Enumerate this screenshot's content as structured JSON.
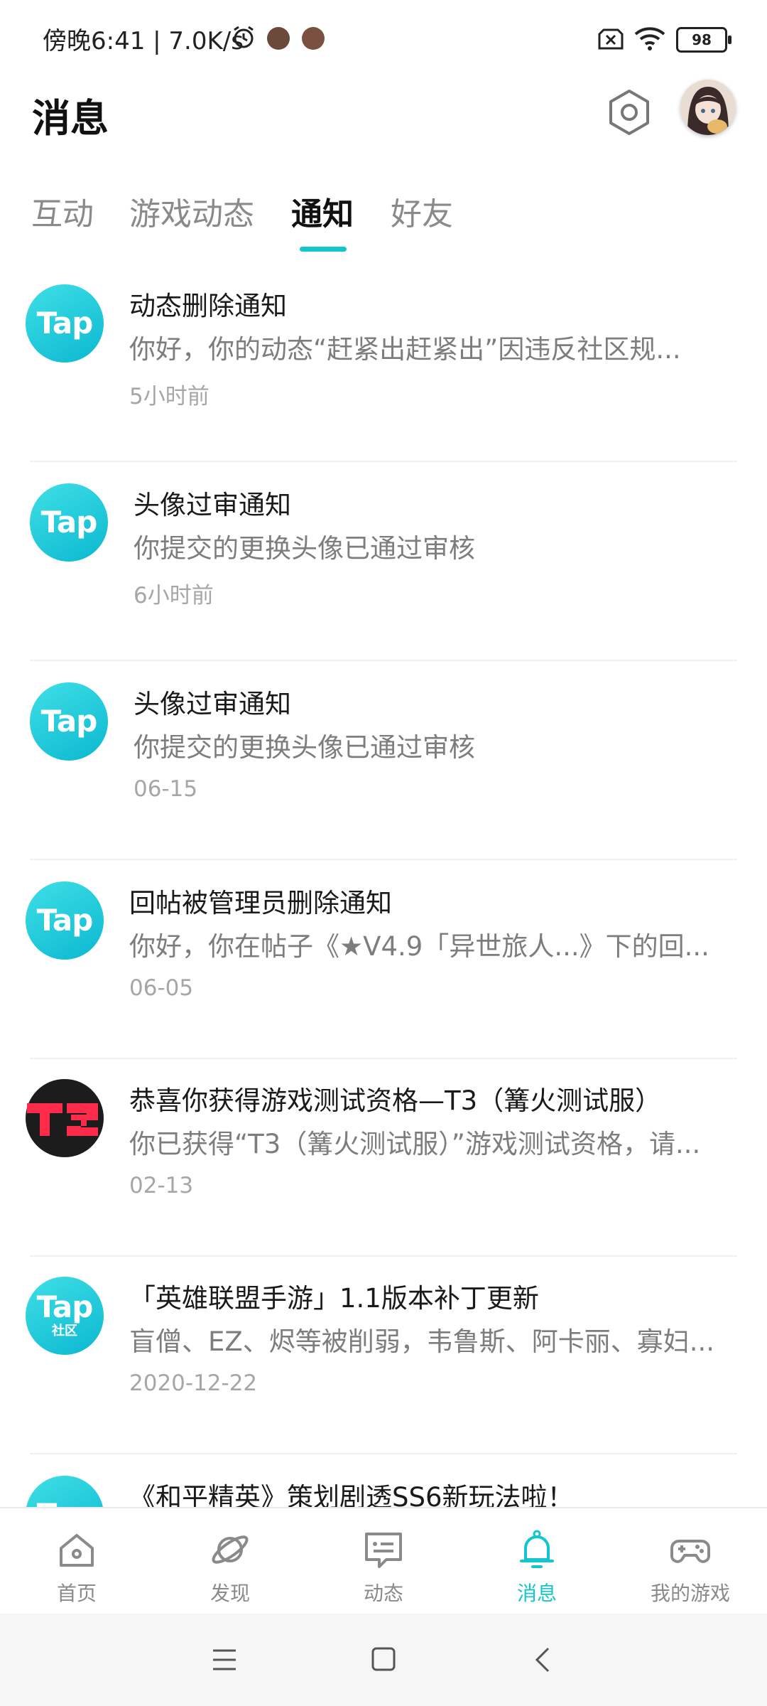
{
  "status_bar": {
    "left_text": "傍晚6:41 | 7.0K/s",
    "battery": "98",
    "icons": [
      "alarm-icon",
      "app-avatar-icon",
      "app-avatar-icon",
      "sim-x-icon",
      "wifi-icon",
      "battery-icon"
    ]
  },
  "header": {
    "title": "消息",
    "settings_icon": "hexagon-settings-icon",
    "avatar_icon": "user-avatar"
  },
  "tabs": [
    {
      "label": "互动",
      "active": false
    },
    {
      "label": "游戏动态",
      "active": false
    },
    {
      "label": "通知",
      "active": true
    },
    {
      "label": "好友",
      "active": false
    }
  ],
  "accent_color": "#15c5ce",
  "notifications": [
    {
      "icon": "Tap",
      "icon_sub": "",
      "title": "动态删除通知",
      "desc": "你好，你的动态“赶紧出赶紧出”因违反社区规...",
      "time": "5小时前"
    },
    {
      "icon": "Tap",
      "icon_sub": "",
      "title": "头像过审通知",
      "desc": "你提交的更换头像已通过审核",
      "time": "6小时前"
    },
    {
      "icon": "Tap",
      "icon_sub": "",
      "title": "头像过审通知",
      "desc": "你提交的更换头像已通过审核",
      "time": "06-15"
    },
    {
      "icon": "Tap",
      "icon_sub": "",
      "title": "回帖被管理员删除通知",
      "desc": "你好，你在帖子《★V4.9「异世旅人...》下的回...",
      "time": "06-05"
    },
    {
      "icon": "T3",
      "icon_sub": "",
      "title": "恭喜你获得游戏测试资格—T3（篝火测试服）",
      "desc": "你已获得“T3（篝火测试服）”游戏测试资格，请...",
      "time": "02-13"
    },
    {
      "icon": "Tap",
      "icon_sub": "社区",
      "title": "「英雄联盟手游」1.1版本补丁更新",
      "desc": "盲僧、EZ、烬等被削弱，韦鲁斯、阿卡丽、寡妇...",
      "time": "2020-12-22"
    },
    {
      "icon": "Tap",
      "icon_sub": "",
      "title": "《和平精英》策划剧透SS6新玩法啦！",
      "desc": "",
      "time": ""
    }
  ],
  "bottom_nav": [
    {
      "label": "首页",
      "icon": "home-icon",
      "active": false
    },
    {
      "label": "发现",
      "icon": "planet-icon",
      "active": false
    },
    {
      "label": "动态",
      "icon": "message-card-icon",
      "active": false
    },
    {
      "label": "消息",
      "icon": "bell-icon",
      "active": true
    },
    {
      "label": "我的游戏",
      "icon": "gamepad-icon",
      "active": false
    }
  ],
  "system_nav": [
    "menu-icon",
    "home-square-icon",
    "back-icon"
  ]
}
